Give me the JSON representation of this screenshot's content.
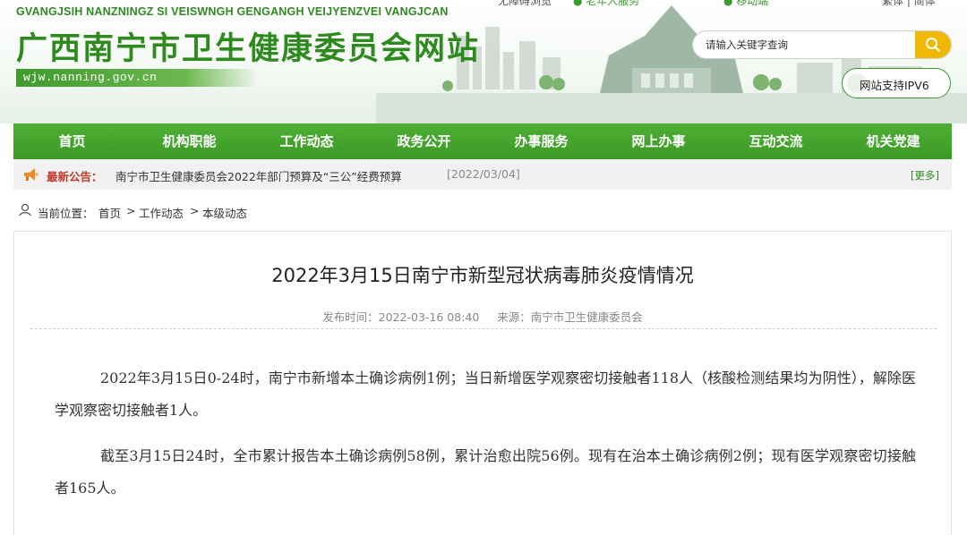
{
  "header": {
    "pinyin": "GVANGJSIH NANZNINGZ SI VEISWNGH GENGANGH VEIJYENZVEI VANGJCAN",
    "title": "广西南宁市卫生健康委员会网站",
    "domain": "wjw.nanning.gov.cn",
    "search_placeholder": "请输入关键字查询",
    "ipv6_label": "网站支持IPV6"
  },
  "nav": [
    "首页",
    "机构职能",
    "工作动态",
    "政务公开",
    "办事服务",
    "网上办事",
    "互动交流",
    "机关党建"
  ],
  "notice": {
    "label": "最新公告：",
    "text": "南宁市卫生健康委员会2022年部门预算及“三公”经费预算",
    "date": "[2022/03/04]",
    "more": "[更多]"
  },
  "breadcrumb": {
    "prefix": "当前位置：",
    "items": [
      "首页",
      "工作动态",
      "本级动态"
    ],
    "separator": ">"
  },
  "article": {
    "title": "2022年3月15日南宁市新型冠状病毒肺炎疫情情况",
    "publish": "发布时间：2022-03-16 08:40",
    "source": "来源：南宁市卫生健康委员会",
    "paragraphs": [
      "2022年3月15日0-24时，南宁市新增本土确诊病例1例；当日新增医学观察密切接触者118人（核酸检测结果均为阴性），解除医学观察密切接触者1人。",
      "截至3月15日24时，全市累计报告本土确诊病例58例，累计治愈出院56例。现有在治本土确诊病例2例；现有医学观察密切接触者165人。"
    ]
  },
  "colors": {
    "brand_green": "#3a9a2c",
    "nav_green": "#45a52d",
    "search_yellow": "#f0b800",
    "notice_red": "#c0392b"
  }
}
